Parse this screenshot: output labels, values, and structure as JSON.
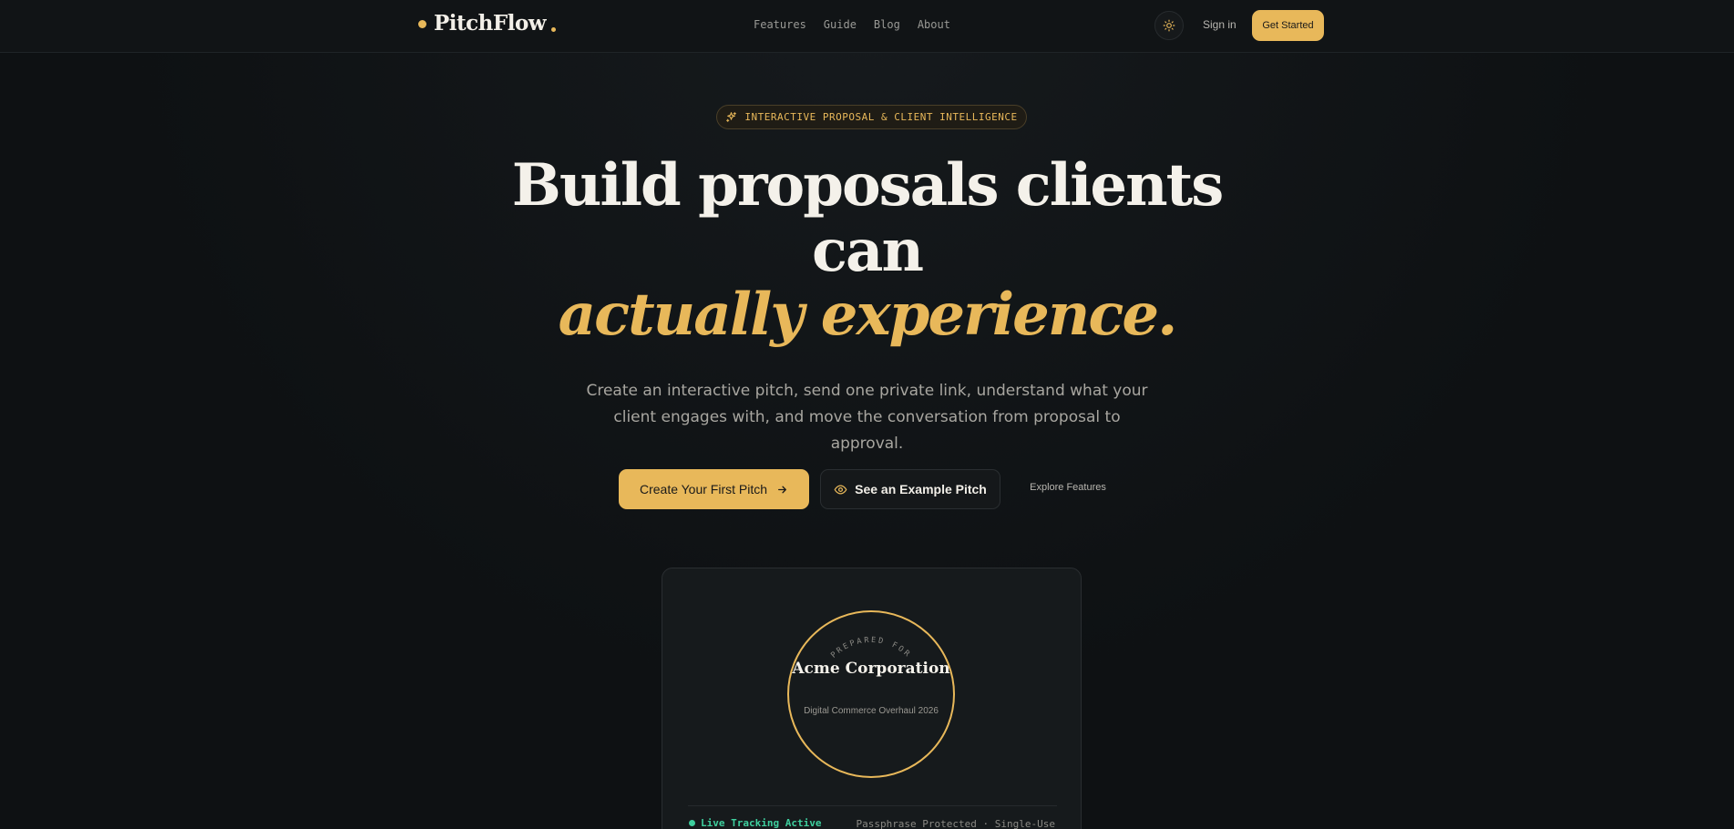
{
  "nav": {
    "brand": "PitchFlow",
    "links": [
      "Features",
      "Guide",
      "Blog",
      "About"
    ],
    "theme_icon": "sun-icon",
    "signin": "Sign in",
    "cta": "Get Started"
  },
  "hero": {
    "badge_icon": "sparkles-icon",
    "badge": "INTERACTIVE PROPOSAL & CLIENT INTELLIGENCE",
    "title_line1": "Build proposals clients",
    "title_line2": "can",
    "title_accent": "actually experience.",
    "subtitle": "Create an interactive pitch, send one private link, understand what your client engages with, and move the conversation from proposal to approval.",
    "primary_cta": "Create Your First Pitch",
    "secondary_cta": "See an Example Pitch",
    "tertiary_link": "Explore Features"
  },
  "preview": {
    "ring_label": "PREPARED FOR",
    "client_name": "Acme Corporation",
    "project": "Digital Commerce Overhaul 2026",
    "status": "Live Tracking Active",
    "security": "Passphrase Protected · Single-Use"
  },
  "colors": {
    "accent": "#e8b85a",
    "background": "#0e1113",
    "status_green": "#3ecf9e"
  }
}
